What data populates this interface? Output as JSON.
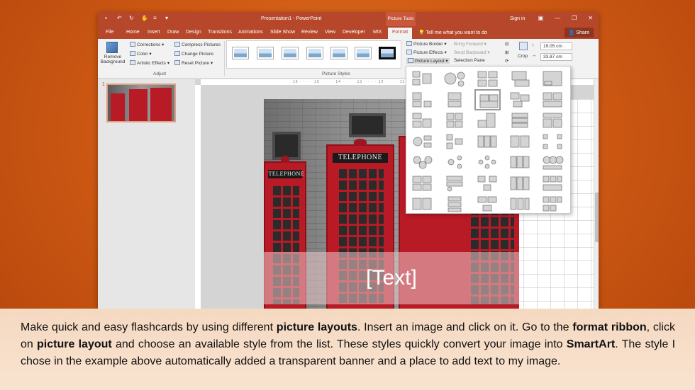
{
  "titlebar": {
    "document_title": "Presentation1 - PowerPoint",
    "contextual_tab_group": "Picture Tools",
    "sign_in": "Sign in",
    "share": "Share"
  },
  "tabs": [
    "File",
    "Home",
    "Insert",
    "Draw",
    "Design",
    "Transitions",
    "Animations",
    "Slide Show",
    "Review",
    "View",
    "Developer",
    "MIX",
    "Format"
  ],
  "active_tab": "Format",
  "tell_me": "Tell me what you want to do",
  "ribbon": {
    "remove_background": [
      "Remove",
      "Background"
    ],
    "corrections": "Corrections",
    "color": "Color",
    "artistic_effects": "Artistic Effects",
    "compress_pictures": "Compress Pictures",
    "change_picture": "Change Picture",
    "reset_picture": "Reset Picture",
    "adjust_label": "Adjust",
    "picture_styles_label": "Picture Styles",
    "picture_border": "Picture Border",
    "picture_effects": "Picture Effects",
    "picture_layout": "Picture Layout",
    "bring_forward": "Bring Forward",
    "send_backward": "Send Backward",
    "selection_pane": "Selection Pane",
    "crop": "Crop",
    "height": "19.05 cm",
    "width": "33.87 cm"
  },
  "slide_panel": {
    "slide_number": "1"
  },
  "ruler_text": "16 · · · · 15 · · · · 14 · · · · 13 · · · · 12 · · · · 11 · · · · 10",
  "photo": {
    "booth_sign": "TELEPHONE"
  },
  "banner_text": "[Text]",
  "caption": {
    "p1": "Make quick and easy flashcards by using different ",
    "b1": "picture layouts",
    "p2": ". Insert an image and click on it. Go to the ",
    "b2": "format ribbon",
    "p3": ", click on ",
    "b3": "picture layout",
    "p4": " and choose an available style from the list. These styles quickly convert your image into ",
    "b4": "SmartArt",
    "p5": ". The style I chose in the example above automatically added a transparent banner and a place to add text to my image."
  },
  "colors": {
    "ppt_red": "#b7472a",
    "slide_bg": "#ffffff",
    "background_orange": "#cf5a14",
    "caption_bg": "#f7dcc6"
  }
}
